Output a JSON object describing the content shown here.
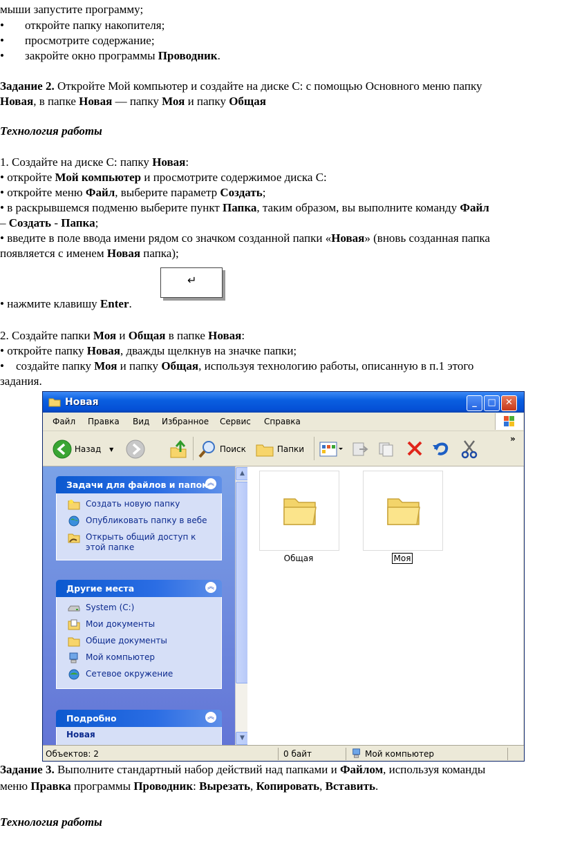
{
  "text": {
    "l1": "мыши запустите программу;",
    "bullet": "•",
    "l2": "откройте папку накопителя;",
    "l3": "просмотрите содержание;",
    "l4a": "закройте окно программы ",
    "l4b": "Проводник",
    "l4c": ".",
    "z2a": "Задание 2.",
    "z2b": " Откройте Мой компьютер и создайте на диске С: с помощью Основного меню папку",
    "z2c": "Новая",
    "z2d": ", в папке ",
    "z2e": "Новая",
    "z2f": " — папку ",
    "z2g": "Моя",
    "z2h": " и папку ",
    "z2i": "Общая",
    "tech1": "Технология работы",
    "s1a": "1.   Создайте на диске С: папку ",
    "s1b": "Новая",
    "s1c": ":",
    "b1a": " откройте ",
    "b1b": "Мой компьютер",
    "b1c": " и просмотрите содержимое диска С:",
    "b2a": " откройте меню ",
    "b2b": "Файл",
    "b2c": ", выберите параметр ",
    "b2d": "Создать",
    "b2e": ";",
    "b3a": " в раскрывшемся подменю выберите пункт ",
    "b3b": "Папка",
    "b3c": ", таким образом, вы выполните команду ",
    "b3d": "Файл",
    "b3e": "– ",
    "b3f": "Создать",
    "b3g": " - ",
    "b3h": "Папка",
    "b3i": ";",
    "b4a": " введите в поле ввода имени рядом со значком созданной папки «",
    "b4b": "Новая",
    "b4c": "» (вновь созданная папка",
    "b4d": "появляется с именем ",
    "b4e": "Новая",
    "b4f": " папка);",
    "b5a": " нажмите клавишу ",
    "b5b": "Enter",
    "b5c": ".",
    "enter_glyph": "↵",
    "s2a": "2.   Создайте папки ",
    "s2b": "Моя",
    "s2c": " и ",
    "s2d": "Общая",
    "s2e": " в папке ",
    "s2f": "Новая",
    "s2g": ":",
    "b6a": " откройте папку ",
    "b6b": "Новая",
    "b6c": ", дважды щелкнув на значке папки;",
    "b7a": "    создайте папку ",
    "b7b": "Моя",
    "b7c": " и папку ",
    "b7d": "Общая",
    "b7e": ", используя технологию работы, описанную в п.1 этого",
    "b7f": "задания.",
    "z3a": "Задание 3.",
    "z3b": " Выполните стандартный набор действий над папками и ",
    "z3c": "Файлом",
    "z3d": ", используя команды",
    "z3e": "меню ",
    "z3f": "Правка",
    "z3g": " программы ",
    "z3h": "Проводник",
    "z3i": ": ",
    "z3j": "Вырезать",
    "z3k": ", ",
    "z3l": "Копировать",
    "z3m": ", ",
    "z3n": "Вставить",
    "z3o": ".",
    "tech2": "Технология работы"
  },
  "window": {
    "title": "Новая",
    "menu": [
      "Файл",
      "Правка",
      "Вид",
      "Избранное",
      "Сервис",
      "Справка"
    ],
    "toolbar": {
      "back": "Назад",
      "search": "Поиск",
      "folders": "Папки",
      "more": "»"
    },
    "tasks": {
      "title": "Задачи для файлов и папок",
      "items": [
        "Создать новую папку",
        "Опубликовать папку в вебе",
        "Открыть общий доступ к",
        "этой папке"
      ]
    },
    "places": {
      "title": "Другие места",
      "items": [
        "System (C:)",
        "Мои документы",
        "Общие документы",
        "Мой компьютер",
        "Сетевое окружение"
      ]
    },
    "details": {
      "title": "Подробно",
      "partial": "Новая"
    },
    "files": [
      "Общая",
      "Моя"
    ],
    "status": {
      "objects": "Объектов: 2",
      "size": "0 байт",
      "location": "Мой компьютер"
    }
  }
}
